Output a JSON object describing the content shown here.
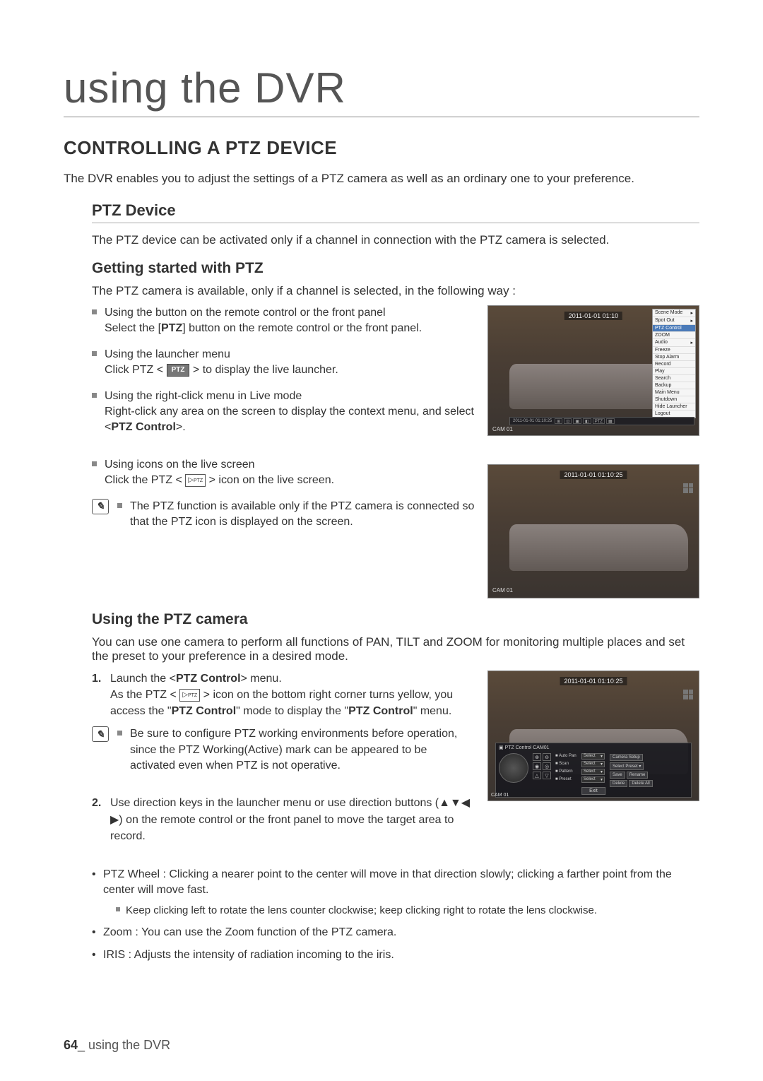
{
  "page_title": "using the DVR",
  "h2": "CONTROLLING A PTZ DEVICE",
  "intro": "The DVR enables you to adjust the settings of a PTZ camera as well as an ordinary one to your preference.",
  "h3_1": "PTZ Device",
  "ptz_device_text": "The PTZ device can be activated only if a channel in connection with the PTZ camera is selected.",
  "h4_getting_started": "Getting started with PTZ",
  "gs_intro": "The PTZ camera is available, only if a channel is selected, in the following way :",
  "gs_items": [
    {
      "t": "Using the button on the remote control or the front panel",
      "d_pre": "Select the [",
      "d_bold": "PTZ",
      "d_post": "] button on the remote control or the front panel."
    },
    {
      "t": "Using the launcher menu",
      "d_pre": "Click PTZ < ",
      "btn": "PTZ",
      "d_post": " > to display the live launcher."
    },
    {
      "t": "Using the right-click menu in Live mode",
      "d_pre": "Right-click any area on the screen to display the context menu, and select <",
      "d_bold": "PTZ Control",
      "d_post": ">."
    },
    {
      "t": "Using icons on the live screen",
      "d_pre": "Click the PTZ < ",
      "icon": "PTZ",
      "d_post": " > icon on the live screen."
    }
  ],
  "gs_note": "The PTZ function is available only if the PTZ camera is connected so that the PTZ icon is displayed on the screen.",
  "h4_using": "Using the PTZ camera",
  "using_intro": "You can use one camera to perform all functions of PAN, TILT and ZOOM for monitoring multiple places and set the preset to your preference in a desired mode.",
  "step1_pre": "Launch the <",
  "step1_bold": "PTZ Control",
  "step1_post": "> menu.",
  "step1_line2_pre": "As the PTZ < ",
  "step1_icon": "PTZ",
  "step1_line2_mid": " > icon on the bottom right corner turns yellow, you access the \"",
  "step1_bold2": "PTZ Control",
  "step1_line2_mid2": "\" mode to display the \"",
  "step1_bold3": "PTZ Control",
  "step1_line2_post": "\" menu.",
  "step1_note": "Be sure to configure PTZ working environments before operation, since the PTZ Working(Active) mark can be appeared to be activated even when PTZ is not operative.",
  "step2": "Use direction keys in the launcher menu or use direction buttons (▲▼◀ ▶) on the remote control or the front panel to move the target area to record.",
  "bullets": [
    "PTZ Wheel : Clicking a nearer point to the center will move in that direction slowly; clicking a farther point from the center will move fast.",
    "Zoom : You can use the Zoom function of the PTZ camera.",
    "IRIS : Adjusts the intensity of radiation incoming to the iris."
  ],
  "sub_bullet": "Keep clicking left to rotate the lens counter clockwise; keep clicking right to rotate the lens clockwise.",
  "footer_num": "64",
  "footer_text": "_ using the DVR",
  "shot1": {
    "timestamp": "2011-01-01 01:10",
    "cam": "CAM 01",
    "launcher_ts": "2011-01-01 01:10:25",
    "menu": [
      "Scene Mode",
      "Spot Out",
      "PTZ Control",
      "ZOOM",
      "Audio",
      "Freeze",
      "Stop Alarm",
      "Record",
      "Play",
      "Search",
      "Backup",
      "Main Menu",
      "Shutdown",
      "Hide Launcher",
      "Logout"
    ],
    "menu_hl_index": 2
  },
  "shot2": {
    "timestamp": "2011-01-01 01:10:25",
    "cam": "CAM 01"
  },
  "shot3": {
    "timestamp": "2011-01-01 01:10:25",
    "panel_title": "PTZ Control  CAM01",
    "cam": "CAM 01",
    "rows": [
      {
        "lab": "Auto Pan",
        "sel": "Select"
      },
      {
        "lab": "Scan",
        "sel": "Select"
      },
      {
        "lab": "Pattern",
        "sel": "Select"
      },
      {
        "lab": "Preset",
        "sel": "Select"
      }
    ],
    "btns": [
      "Camera Setup",
      "Select Preset",
      "Save",
      "Rename",
      "Delete",
      "Delete All"
    ],
    "exit": "Exit"
  }
}
